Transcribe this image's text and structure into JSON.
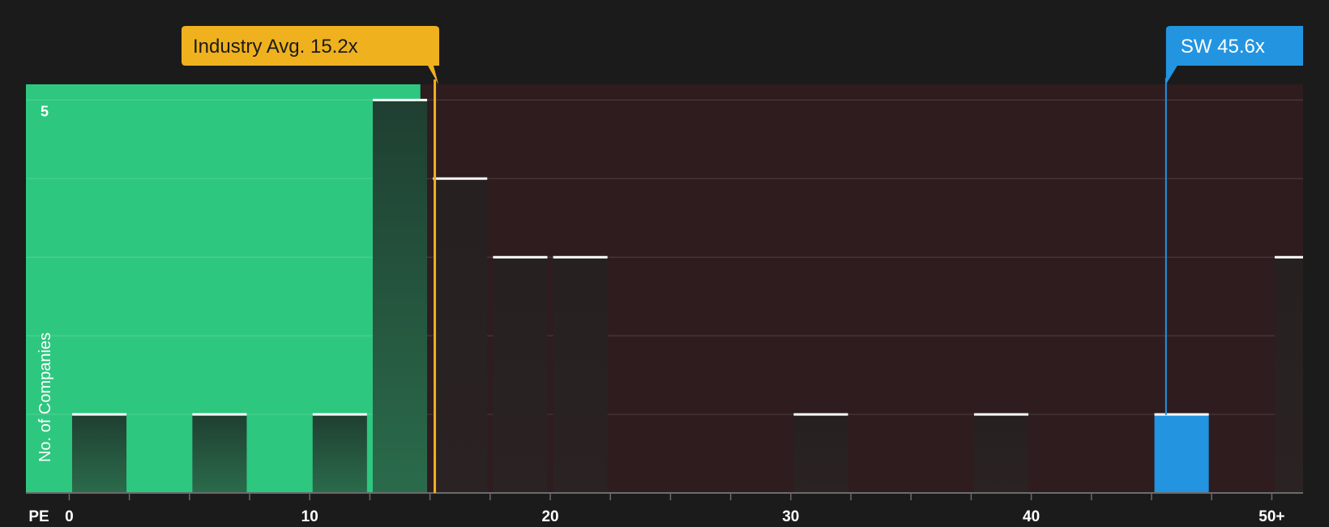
{
  "chart_data": {
    "type": "bar",
    "x_axis_label": "PE",
    "y_axis_label": "No. of Companies",
    "x_tick_labels": [
      "0",
      "10",
      "20",
      "30",
      "40",
      "50+"
    ],
    "x_tick_values": [
      0,
      10,
      20,
      30,
      40,
      50
    ],
    "y_tick_labels": [
      "5"
    ],
    "y_tick_values": [
      5
    ],
    "xlim": [
      -1.8,
      51.3
    ],
    "ylim": [
      0,
      5.2
    ],
    "bin_width": 2.5,
    "bars": [
      {
        "x_start": 0,
        "value": 1
      },
      {
        "x_start": 5,
        "value": 1
      },
      {
        "x_start": 10,
        "value": 1
      },
      {
        "x_start": 12.5,
        "value": 5
      },
      {
        "x_start": 15,
        "value": 4
      },
      {
        "x_start": 17.5,
        "value": 3
      },
      {
        "x_start": 20,
        "value": 3
      },
      {
        "x_start": 30,
        "value": 1
      },
      {
        "x_start": 37.5,
        "value": 1
      },
      {
        "x_start": 45,
        "value": 1,
        "highlight": true
      },
      {
        "x_start": 50,
        "value": 3
      }
    ],
    "industry_avg": {
      "label": "Industry Avg. 15.2x",
      "value": 15.2
    },
    "company": {
      "label": "SW 45.6x",
      "value": 45.6
    },
    "undervalued_region_end": 14.6,
    "colors": {
      "background": "#1b1b1b",
      "undervalued_region": "#2ec77f",
      "overvalued_region": "#2e1c1e",
      "bar_in_green": "#234a38",
      "bar_in_red": "#2a2121",
      "bar_top_line": "#ffffff",
      "highlight_bar": "#2394e0",
      "industry_marker": "#f0b11f",
      "company_marker": "#2394e0",
      "gridline": "#4a3a3c",
      "axis_text": "#ffffff"
    }
  }
}
